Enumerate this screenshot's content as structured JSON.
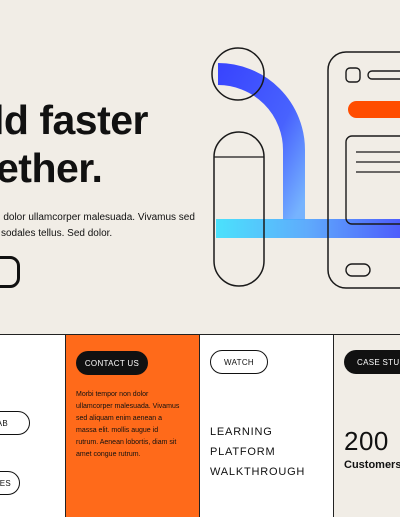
{
  "hero": {
    "headline_line1": "ld faster",
    "headline_line2": "ether.",
    "body_line1": "n dolor ullamcorper malesuada. Vivamus sed",
    "body_line2": "l sodales tellus. Sed dolor.",
    "cta_label": ""
  },
  "illustration": {
    "accent_color": "#ff4d00",
    "stroke_color": "#1a1a1a",
    "blue_color": "#2f3cff",
    "cyan_color": "#38d4ff"
  },
  "cards": {
    "card1": {
      "pill_top": "LAB",
      "pill_bottom": "ES"
    },
    "card2": {
      "pill": "CONTACT US",
      "text_lines": [
        "Morbi tempor non dolor",
        "ullamcorper malesuada. Vivamus",
        "sed aliquam enim aenean a",
        "massa elit. mollis augue id",
        "rutrum. Aenean lobortis, diam sit",
        "amet congue rutrum."
      ]
    },
    "card3": {
      "pill": "WATCH",
      "title_lines": [
        "LEARNING",
        "PLATFORM",
        "WALKTHROUGH"
      ]
    },
    "card4": {
      "pill": "CASE STUDI",
      "stat_value": "200",
      "stat_label": "Customers"
    }
  },
  "colors": {
    "background": "#f1ede6",
    "orange": "#ff6a1a",
    "dark": "#111111"
  }
}
